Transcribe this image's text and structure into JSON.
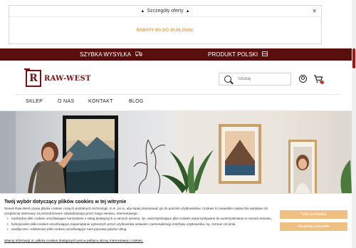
{
  "promo": {
    "header_label": "Szczegóły oferty",
    "close_symbol": "✕",
    "text": "RABATY 5% DO 30.06.2026r."
  },
  "topbar": {
    "item1": "SZYBKA WYSYŁKA",
    "item2": "PRODUKT POLSKI",
    "bg_color": "#5a0f0f"
  },
  "header": {
    "logo_letter": "R",
    "logo_text": "RAW-WEST",
    "search_placeholder": "Szukaj"
  },
  "nav": {
    "items": [
      "SKLEP",
      "O NAS",
      "KONTAKT",
      "BLOG"
    ]
  },
  "cookie": {
    "title": "Twój wybór dotyczący plików cookies w tej witrynie",
    "intro": "Serwis Raw-West używa plików cookies i innych podobnych technologii, m.in. po to, aby lepiej dostosować go do potrzeb użytkowników. Cookies to niewielkie ciasteczka wysyłane do urządzenia internauty za pośrednictwem odwiedzanego przez niego serwisu. Internetowego:",
    "bullets": [
      "niezbędne pliki cookies umożliwiające korzystanie z usług dostępnych w ramach serwisu, np. uwierzytelniające pliki cookies wykorzystywane do uwierzytelniania w ramach serwisu,",
      "funkcjonalne pliki cookies umożliwiające zapamiętanie wybranych przez użytkownika ustawień i personalizację interfejsu użytkownika, np. rozmiar czcionki,",
      "analityczne i reklamowe pliki cookies umożliwiające nam poprawę jakości usług"
    ],
    "link": "Więcej informacji nt. plików cookies dostępnych jest w polityce strony internetowej i cookies.",
    "button1": "Tylko niezbędne",
    "button2": "Akceptuję wszystkie"
  }
}
